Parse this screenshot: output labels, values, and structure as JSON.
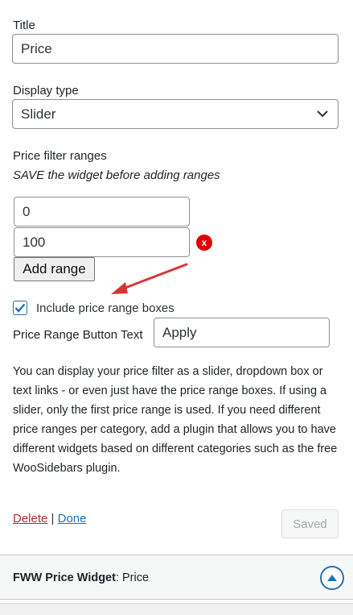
{
  "title_field": {
    "label": "Title",
    "value": "Price"
  },
  "display_type": {
    "label": "Display type",
    "selected": "Slider"
  },
  "ranges": {
    "label": "Price filter ranges",
    "note": "SAVE the widget before adding ranges",
    "values": [
      "0",
      "100"
    ],
    "remove_label": "x",
    "add_button": "Add range"
  },
  "include_boxes": {
    "label": "Include price range boxes",
    "checked": true
  },
  "button_text": {
    "label": "Price Range Button Text",
    "value": "Apply"
  },
  "description": "You can display your price filter as a slider, dropdown box or text links - or even just have the price range boxes. If using a slider, only the first price range is used. If you need different price ranges per category, add a plugin that allows you to have different widgets based on different categories such as the free WooSidebars plugin.",
  "actions": {
    "delete": "Delete",
    "separator": "|",
    "done": "Done",
    "saved": "Saved"
  },
  "widget_footer": {
    "name": "FWW Price Widget",
    "suffix": ": Price"
  },
  "colors": {
    "accent": "#2271b1",
    "remove": "#e00000",
    "arrow": "#d63638"
  }
}
